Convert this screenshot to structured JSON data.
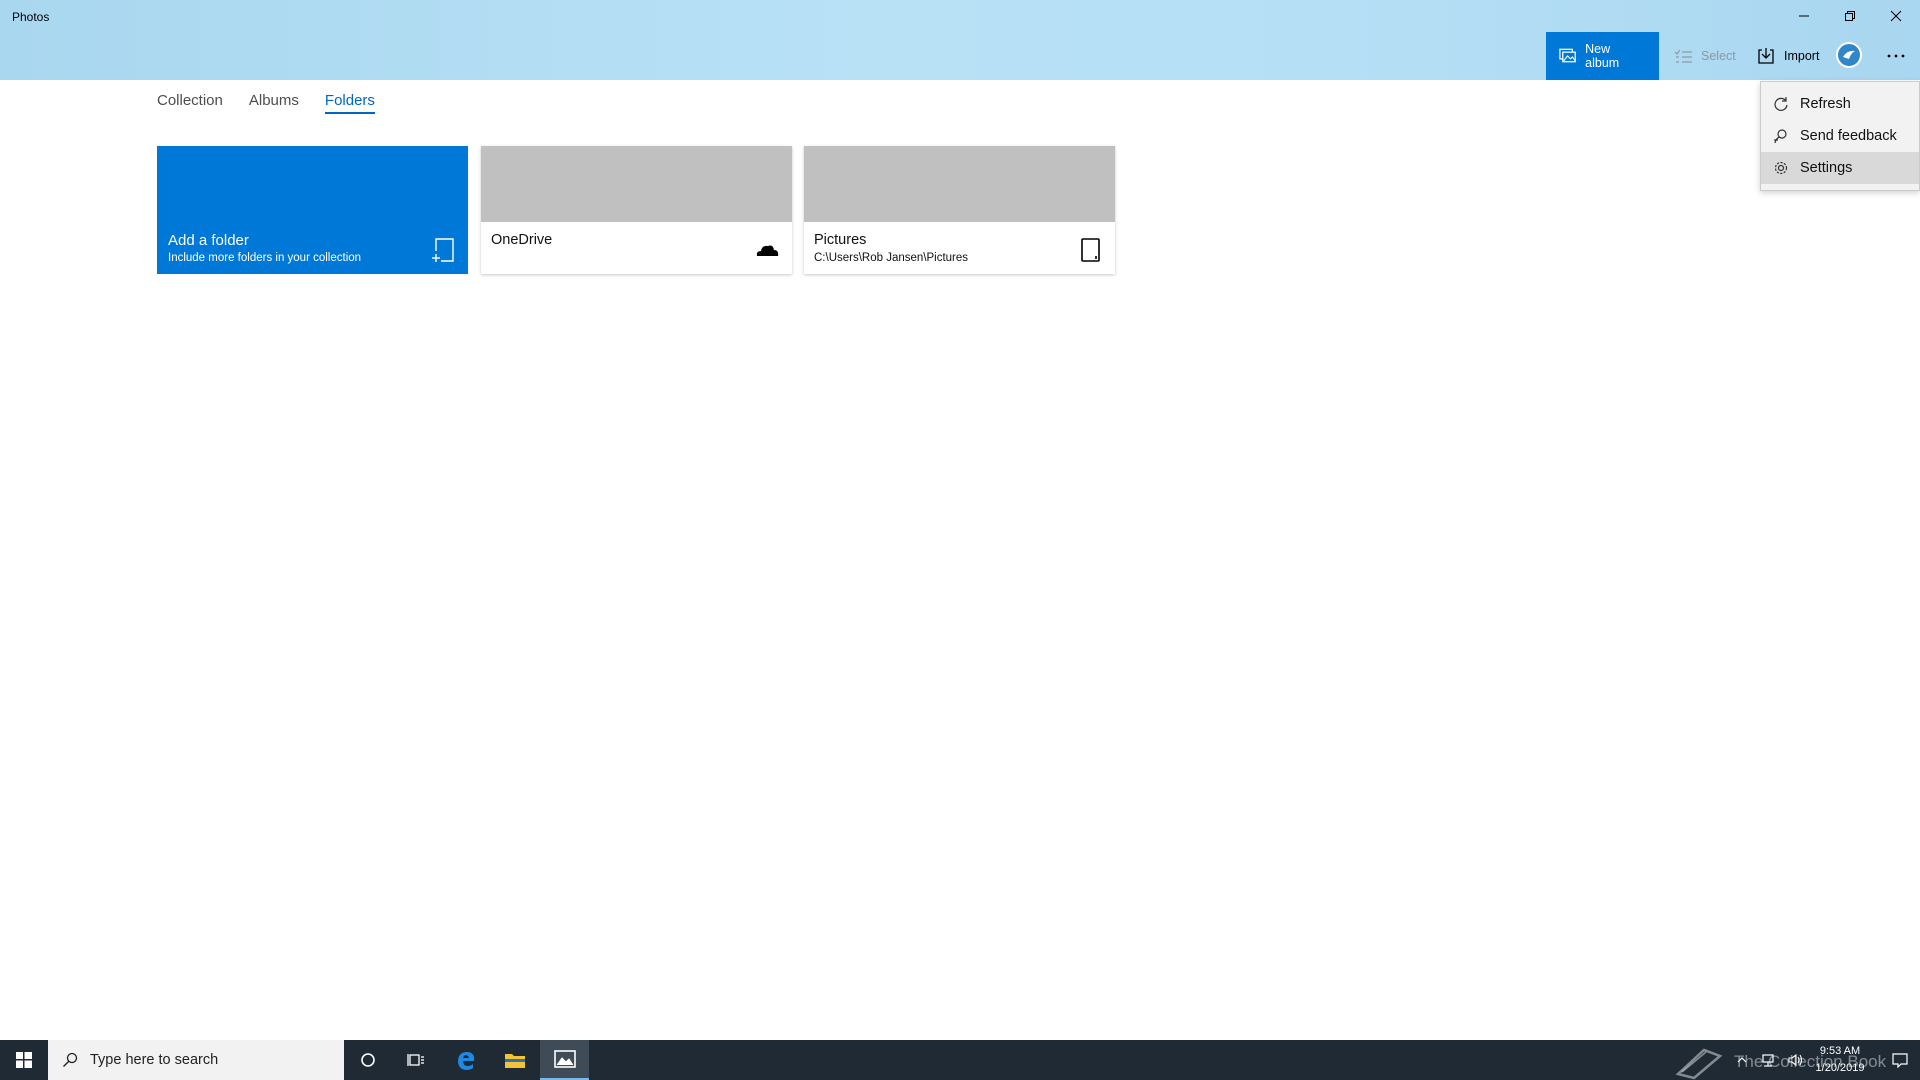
{
  "app": {
    "title": "Photos"
  },
  "toolbar": {
    "new_album_label": "New album",
    "select_label": "Select",
    "import_label": "Import"
  },
  "tabs": [
    {
      "label": "Collection",
      "active": false
    },
    {
      "label": "Albums",
      "active": false
    },
    {
      "label": "Folders",
      "active": true
    }
  ],
  "tiles": {
    "add_folder": {
      "title": "Add a folder",
      "subtitle": "Include more folders in your collection",
      "icon": "add-folder-icon"
    },
    "onedrive": {
      "title": "OneDrive",
      "icon": "cloud-icon"
    },
    "pictures": {
      "title": "Pictures",
      "path": "C:\\Users\\Rob Jansen\\Pictures",
      "icon": "device-icon"
    }
  },
  "more_menu": {
    "items": [
      {
        "label": "Refresh",
        "icon": "refresh-icon"
      },
      {
        "label": "Send feedback",
        "icon": "feedback-icon"
      },
      {
        "label": "Settings",
        "icon": "gear-icon"
      }
    ]
  },
  "taskbar": {
    "search_placeholder": "Type here to search",
    "time": "9:53 AM",
    "date": "1/20/2019",
    "watermark": "The Collection Book"
  },
  "colors": {
    "accent": "#0078d7",
    "titlebar": "#b5dff5",
    "taskbar": "#1f2a35",
    "tile_placeholder": "#c0c0c0"
  }
}
